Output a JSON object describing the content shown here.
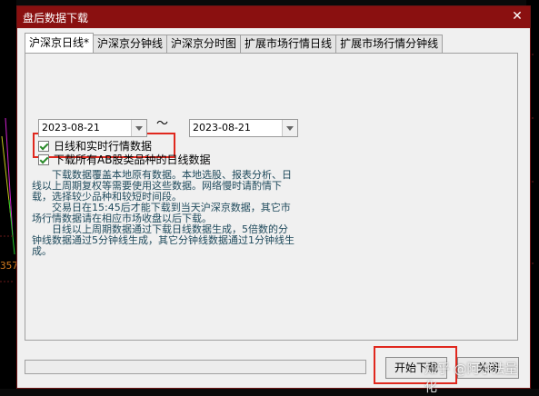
{
  "window": {
    "title": "盘后数据下载",
    "close_glyph": "✕"
  },
  "tabs": [
    {
      "label": "沪深京日线*",
      "active": true
    },
    {
      "label": "沪深京分钟线",
      "active": false
    },
    {
      "label": "沪深京分时图",
      "active": false
    },
    {
      "label": "扩展市场行情日线",
      "active": false
    },
    {
      "label": "扩展市场行情分钟线",
      "active": false
    }
  ],
  "daily_realtime": {
    "label": "日线和实时行情数据",
    "checked": true
  },
  "date_range": {
    "start": "2023-08-21",
    "separator": "～",
    "end": "2023-08-21"
  },
  "ab_daily": {
    "label": "下载所有AB股类品种的日线数据",
    "checked": true
  },
  "info_text": [
    "下载数据覆盖本地原有数据。本地选股、报表分析、日线以上周期复权等需要使用这些数据。网络慢时请酌情下载，选择较少品种和较短时间段。",
    "交易日在15:45后才能下载到当天沪深京数据，其它市场行情数据请在相应市场收盘以后下载。",
    "日线以上周期数据通过下载日线数据生成，5倍数的分钟线数据通过5分钟线生成，其它分钟线数据通过1分钟线生成。"
  ],
  "buttons": {
    "start": "开始下载",
    "close": "关闭"
  },
  "watermark": "知乎 @阿尔法量化",
  "background": {
    "price_label": "357"
  },
  "colors": {
    "title_bar": "#8a1010",
    "highlight": "#e0281e",
    "info_text": "#1f4a5c",
    "check": "#2a8a2a"
  }
}
